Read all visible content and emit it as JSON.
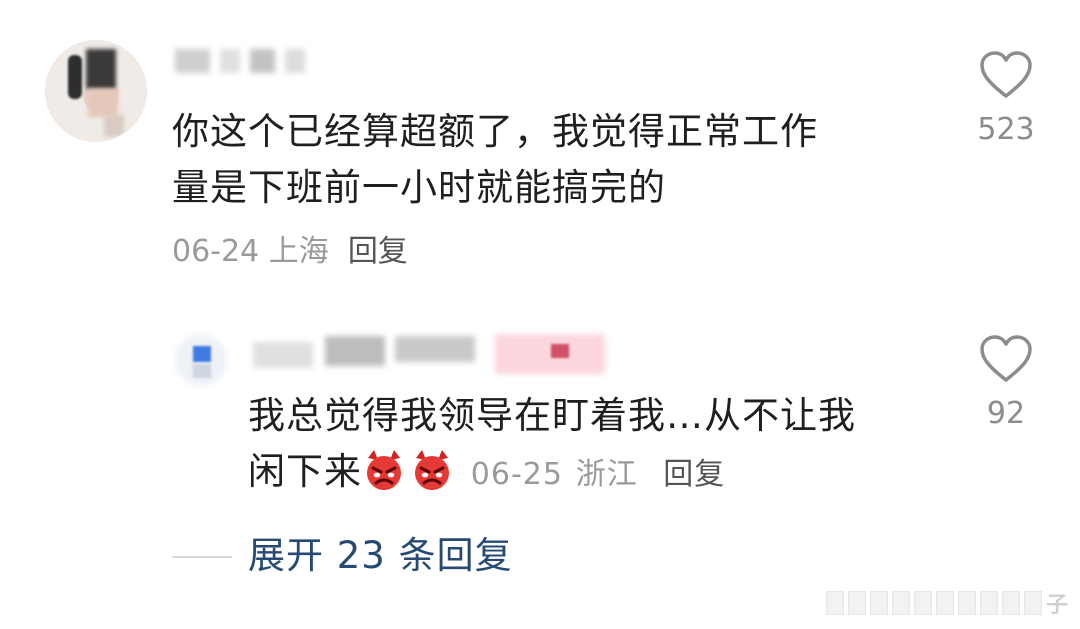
{
  "comment": {
    "text_line1": "你这个已经算超额了，我觉得正常工作",
    "text_line2": "量是下班前一小时就能搞完的",
    "date": "06-24",
    "location": "上海",
    "reply_label": "回复",
    "likes": "523"
  },
  "reply": {
    "text_line1": "我总觉得我领导在盯着我…从不让我",
    "text_line2": "闲下来",
    "emoji": [
      "angry-devil-icon",
      "angry-devil-icon"
    ],
    "date": "06-25",
    "location": "浙江",
    "reply_label": "回复",
    "likes": "92"
  },
  "expand": {
    "label": "展开 23 条回复"
  },
  "watermark": {
    "char": "子"
  },
  "colors": {
    "text": "#1f1f1f",
    "meta": "#9a9a9a",
    "link": "#264a73",
    "heart": "#8c8c8c"
  }
}
